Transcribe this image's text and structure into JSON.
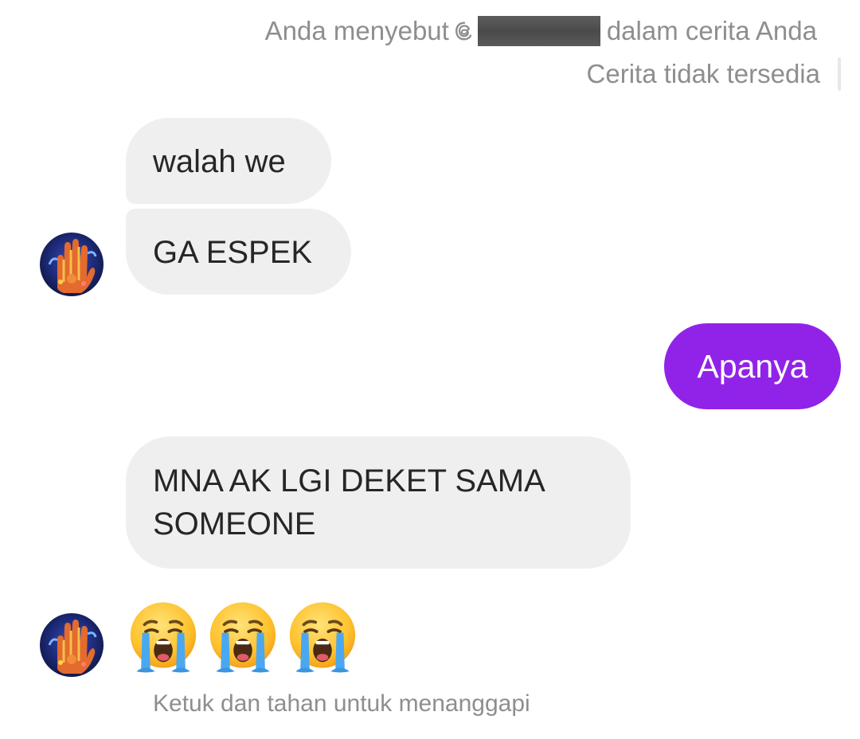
{
  "story": {
    "mention_prefix": "Anda menyebut @",
    "mention_suffix": "dalam cerita Anda",
    "unavailable": "Cerita tidak tersedia"
  },
  "messages": [
    {
      "sender": "them",
      "text": "walah we"
    },
    {
      "sender": "them",
      "text": "GA ESPEK"
    },
    {
      "sender": "me",
      "text": "Apanya"
    },
    {
      "sender": "them",
      "text": "MNA AK LGI DEKET SAMA SOMEONE"
    },
    {
      "sender": "them",
      "text": "😭😭😭"
    }
  ],
  "hint": "Ketuk dan tahan untuk menanggapi",
  "colors": {
    "sent_bubble": "#9123e8",
    "received_bubble": "#efefef",
    "meta_text": "#8e8e8e"
  },
  "icons": [
    "threads-icon",
    "crying-face-emoji",
    "avatar"
  ]
}
